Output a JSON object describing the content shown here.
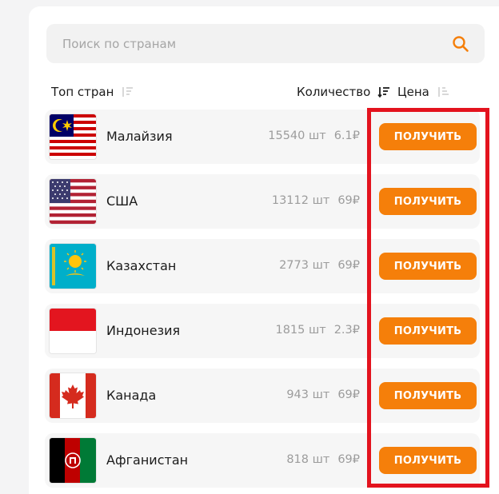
{
  "search": {
    "placeholder": "Поиск по странам",
    "icon": "search-icon",
    "accent": "#f57f0a"
  },
  "columns": {
    "top": "Топ стран",
    "quantity": "Количество",
    "price": "Цена"
  },
  "button_color": "#f57f0a",
  "highlight_color": "#e3131e",
  "countries": [
    {
      "name": "Малайзия",
      "quantity": "15540 шт",
      "price": "6.1₽",
      "button": "ПОЛУЧИТЬ",
      "flag": "malaysia-flag"
    },
    {
      "name": "США",
      "quantity": "13112 шт",
      "price": "69₽",
      "button": "ПОЛУЧИТЬ",
      "flag": "usa-flag"
    },
    {
      "name": "Казахстан",
      "quantity": "2773 шт",
      "price": "69₽",
      "button": "ПОЛУЧИТЬ",
      "flag": "kazakhstan-flag"
    },
    {
      "name": "Индонезия",
      "quantity": "1815 шт",
      "price": "2.3₽",
      "button": "ПОЛУЧИТЬ",
      "flag": "indonesia-flag"
    },
    {
      "name": "Канада",
      "quantity": "943 шт",
      "price": "69₽",
      "button": "ПОЛУЧИТЬ",
      "flag": "canada-flag"
    },
    {
      "name": "Афганистан",
      "quantity": "818 шт",
      "price": "69₽",
      "button": "ПОЛУЧИТЬ",
      "flag": "afghanistan-flag"
    }
  ]
}
